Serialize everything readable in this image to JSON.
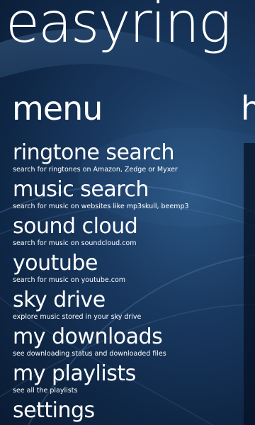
{
  "app": {
    "title": "easyring"
  },
  "pivot": {
    "current": "menu",
    "next_peek": "h"
  },
  "menu": {
    "items": [
      {
        "label": "ringtone search",
        "description": "search for ringtones on Amazon, Zedge or Myxer"
      },
      {
        "label": "music search",
        "description": "search for music on websites like mp3skull, beemp3"
      },
      {
        "label": "sound cloud",
        "description": "search for music on soundcloud.com"
      },
      {
        "label": "youtube",
        "description": "search for music on youtube.com"
      },
      {
        "label": "sky drive",
        "description": "explore music stored in your sky drive"
      },
      {
        "label": "my downloads",
        "description": "see downloading status and downloaded files"
      },
      {
        "label": "my playlists",
        "description": "see all the playlists"
      },
      {
        "label": "settings",
        "description": ""
      }
    ]
  },
  "colors": {
    "background": "#0f2746",
    "accent": "#2b5785",
    "text": "#ffffff"
  }
}
